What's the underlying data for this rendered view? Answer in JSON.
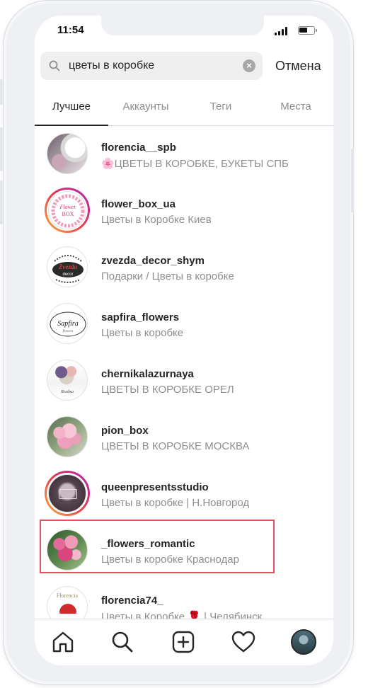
{
  "status": {
    "time": "11:54"
  },
  "search": {
    "query": "цветы в коробке",
    "cancel_label": "Отмена"
  },
  "tabs": [
    {
      "label": "Лучшее",
      "active": true
    },
    {
      "label": "Аккаунты",
      "active": false
    },
    {
      "label": "Теги",
      "active": false
    },
    {
      "label": "Места",
      "active": false
    }
  ],
  "results": [
    {
      "username": "florencia__spb",
      "subtitle": "🌸ЦВЕТЫ В КОРОБКЕ, БУКЕТЫ СПБ",
      "story": false
    },
    {
      "username": "flower_box_ua",
      "subtitle": "Цветы в Коробке Киев",
      "story": true,
      "logo_text": "Flower BOX"
    },
    {
      "username": "zvezda_decor_shym",
      "subtitle": "Подарки / Цветы в коробке",
      "story": false,
      "logo_text": "Zvezda decor"
    },
    {
      "username": "sapfira_flowers",
      "subtitle": "Цветы в коробке",
      "story": false,
      "logo_text": "Sapfira"
    },
    {
      "username": "chernikalazurnaya",
      "subtitle": "ЦВЕТЫ В КОРОБКЕ ОРЕЛ",
      "story": false
    },
    {
      "username": "pion_box",
      "subtitle": "ЦВЕТЫ В КОРОБКЕ МОСКВА",
      "story": false,
      "highlighted": true
    },
    {
      "username": "queenpresentsstudio",
      "subtitle": "Цветы в коробке | Н.Новгород",
      "story": true
    },
    {
      "username": "_flowers_romantic",
      "subtitle": "Цветы в коробке Краснодар",
      "story": false
    },
    {
      "username": "florencia74_",
      "subtitle": "Цветы в Коробке 🌹 | Челябинск",
      "story": false,
      "logo_text": "Florencia"
    }
  ],
  "colors": {
    "highlight": "#e4525e",
    "muted_text": "#8e8e8e",
    "primary_text": "#262626"
  },
  "bottom_nav": [
    "home-icon",
    "search-icon",
    "add-post-icon",
    "heart-icon",
    "profile-avatar"
  ]
}
